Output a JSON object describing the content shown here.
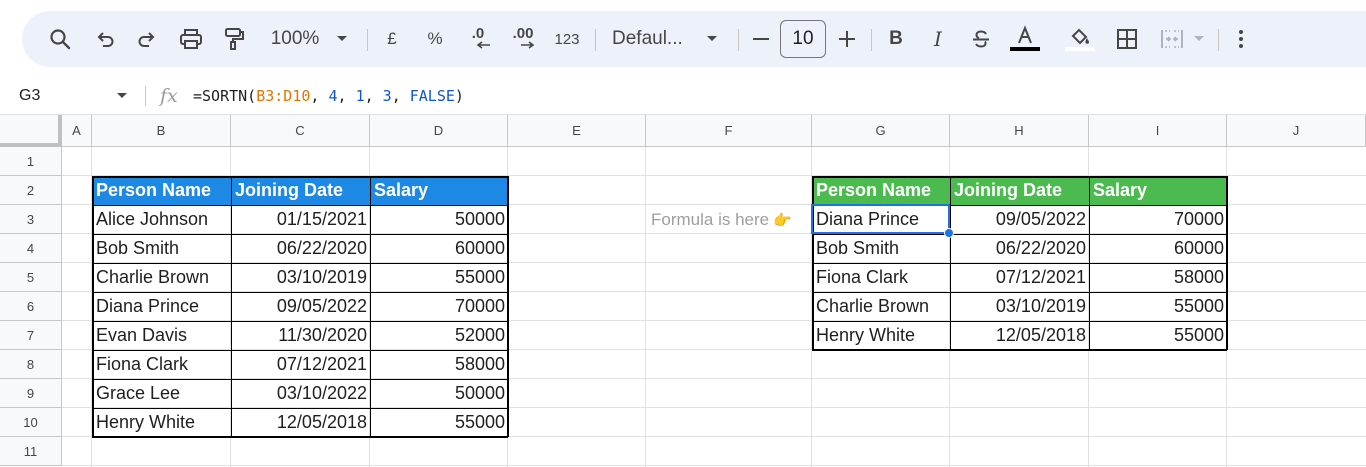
{
  "toolbar": {
    "zoom": "100%",
    "currency_symbol": "£",
    "percent_symbol": "%",
    "decrease_decimal": ".0",
    "increase_decimal": ".00",
    "number_format": "123",
    "font_name": "Defaul...",
    "font_size": "10",
    "icons": [
      "search-icon",
      "undo-icon",
      "redo-icon",
      "print-icon",
      "paint-format-icon",
      "zoom-dropdown-icon",
      "minus-icon",
      "plus-icon",
      "bold-icon",
      "italic-icon",
      "strikethrough-icon",
      "text-color-icon",
      "fill-color-icon",
      "borders-icon",
      "merge-cells-icon",
      "more-vert-icon"
    ]
  },
  "formula_bar": {
    "name_box": "G3",
    "fx_label": "fx",
    "formula_parts": {
      "prefix": "=SORTN(",
      "range": "B3:D10",
      "sep1": ", ",
      "arg1": "4",
      "sep2": ", ",
      "arg2": "1",
      "sep3": ", ",
      "arg3": "3",
      "sep4": ", ",
      "arg4": "FALSE",
      "suffix": ")"
    }
  },
  "grid": {
    "columns": [
      "A",
      "B",
      "C",
      "D",
      "E",
      "F",
      "G",
      "H",
      "I",
      "J"
    ],
    "rows": [
      "1",
      "2",
      "3",
      "4",
      "5",
      "6",
      "7",
      "8",
      "9",
      "10",
      "11"
    ],
    "source_table": {
      "header_color": "#1e88e5",
      "headers": [
        "Person Name",
        "Joining Date",
        "Salary"
      ],
      "rows": [
        [
          "Alice Johnson",
          "01/15/2021",
          "50000"
        ],
        [
          "Bob Smith",
          "06/22/2020",
          "60000"
        ],
        [
          "Charlie Brown",
          "03/10/2019",
          "55000"
        ],
        [
          "Diana Prince",
          "09/05/2022",
          "70000"
        ],
        [
          "Evan Davis",
          "11/30/2020",
          "52000"
        ],
        [
          "Fiona Clark",
          "07/12/2021",
          "58000"
        ],
        [
          "Grace Lee",
          "03/10/2022",
          "50000"
        ],
        [
          "Henry White",
          "12/05/2018",
          "55000"
        ]
      ]
    },
    "result_table": {
      "header_color": "#4cbb4f",
      "headers": [
        "Person Name",
        "Joining Date",
        "Salary"
      ],
      "rows": [
        [
          "Diana Prince",
          "09/05/2022",
          "70000"
        ],
        [
          "Bob Smith",
          "06/22/2020",
          "60000"
        ],
        [
          "Fiona Clark",
          "07/12/2021",
          "58000"
        ],
        [
          "Charlie Brown",
          "03/10/2019",
          "55000"
        ],
        [
          "Henry White",
          "12/05/2018",
          "55000"
        ]
      ]
    },
    "note": "Formula is here",
    "note_icon": "👉",
    "selected_cell": "G3",
    "selection_color": "#1a73e8"
  }
}
